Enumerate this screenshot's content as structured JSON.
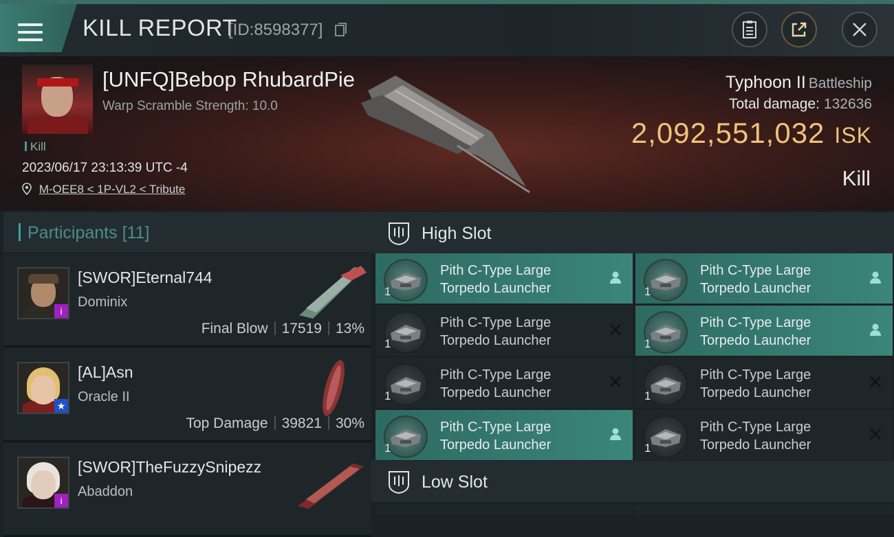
{
  "header": {
    "title": "KILL REPORT",
    "report_id": "[ID:8598377]"
  },
  "victim": {
    "name": "[UNFQ]Bebop RhubardPie",
    "subtitle": "Warp Scramble Strength: 10.0",
    "tag": "Kill",
    "date": "2023/06/17 23:13:39 UTC -4",
    "location": "M-OEE8 < 1P-VL2 < Tribute",
    "ship_name": "Typhoon II",
    "ship_class": "Battleship",
    "total_damage_label": "Total damage:",
    "total_damage": "132636",
    "isk_value": "2,092,551,032",
    "isk_unit": "ISK",
    "result": "Kill"
  },
  "participants": {
    "title": "Participants",
    "count": "[11]",
    "items": [
      {
        "name": "[SWOR]Eternal744",
        "ship": "Dominix",
        "role": "Final Blow",
        "damage": "17519",
        "percent": "13%",
        "badge": "i",
        "badge_color": "#a020c0"
      },
      {
        "name": "[AL]Asn",
        "ship": "Oracle II",
        "role": "Top Damage",
        "damage": "39821",
        "percent": "30%",
        "badge": "★",
        "badge_color": "#2050c8"
      },
      {
        "name": "[SWOR]TheFuzzySnipezz",
        "ship": "Abaddon",
        "role": "",
        "damage": "",
        "percent": "",
        "badge": "i",
        "badge_color": "#a020c0"
      }
    ]
  },
  "slots": {
    "high_title": "High Slot",
    "low_title": "Low Slot",
    "high": [
      {
        "line1": "Pith C-Type Large",
        "line2": "Torpedo Launcher",
        "qty": "1",
        "status": "person-icon",
        "active": true
      },
      {
        "line1": "Pith C-Type Large",
        "line2": "Torpedo Launcher",
        "qty": "1",
        "status": "person-icon",
        "active": true
      },
      {
        "line1": "Pith C-Type Large",
        "line2": "Torpedo Launcher",
        "qty": "1",
        "status": "close-icon",
        "active": false
      },
      {
        "line1": "Pith C-Type Large",
        "line2": "Torpedo Launcher",
        "qty": "1",
        "status": "person-icon",
        "active": true
      },
      {
        "line1": "Pith C-Type Large",
        "line2": "Torpedo Launcher",
        "qty": "1",
        "status": "close-icon",
        "active": false
      },
      {
        "line1": "Pith C-Type Large",
        "line2": "Torpedo Launcher",
        "qty": "1",
        "status": "close-icon",
        "active": false
      },
      {
        "line1": "Pith C-Type Large",
        "line2": "Torpedo Launcher",
        "qty": "1",
        "status": "person-icon",
        "active": true
      },
      {
        "line1": "Pith C-Type Large",
        "line2": "Torpedo Launcher",
        "qty": "1",
        "status": "close-icon",
        "active": false
      }
    ]
  },
  "colors": {
    "accent": "#3b857a",
    "isk": "#f0c27a",
    "teal_text": "#4d8c8c"
  }
}
